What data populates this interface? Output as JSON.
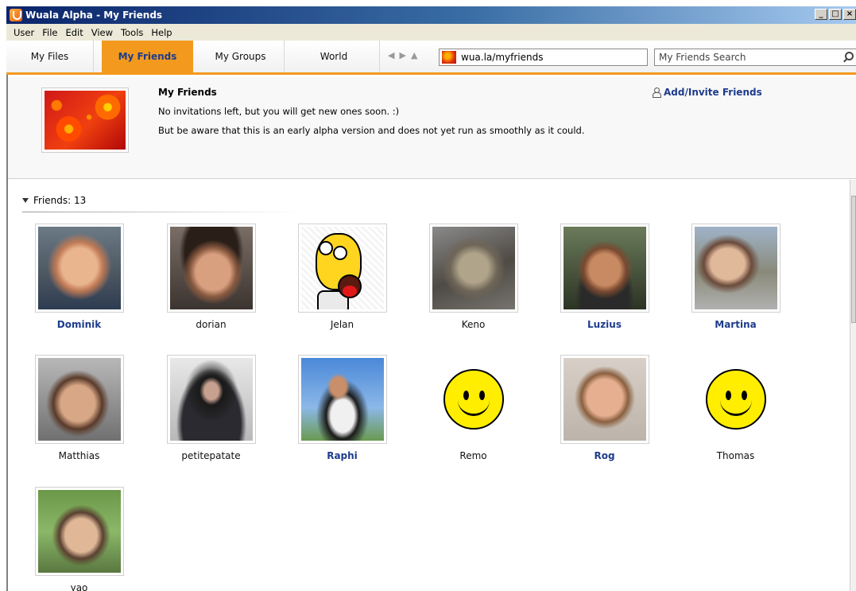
{
  "window": {
    "title": "Wuala Alpha - My Friends",
    "controls": [
      "_",
      "□",
      "×"
    ]
  },
  "menu": [
    "User",
    "File",
    "Edit",
    "View",
    "Tools",
    "Help"
  ],
  "tabs": [
    {
      "label": "My Files",
      "active": false
    },
    {
      "label": "My Friends",
      "active": true
    },
    {
      "label": "My Groups",
      "active": false
    },
    {
      "label": "World",
      "active": false
    }
  ],
  "nav": {
    "back": "◀",
    "forward": "▶",
    "up": "▲"
  },
  "address": {
    "value": "wua.la/myfriends"
  },
  "search": {
    "placeholder": "My Friends Search"
  },
  "header": {
    "title": "My Friends",
    "line1": "No invitations left, but you will get new ones soon. :)",
    "line2": "But be aware that this is an early alpha version and does not yet run as smoothly as it could.",
    "invite_label": "Add/Invite Friends"
  },
  "friends": {
    "label": "Friends: 13",
    "items": [
      {
        "name": "Dominik",
        "bold": true,
        "photo": "photo"
      },
      {
        "name": "dorian",
        "bold": false,
        "photo": "photo"
      },
      {
        "name": "Jelan",
        "bold": false,
        "photo": "cartoon"
      },
      {
        "name": "Keno",
        "bold": false,
        "photo": "photo"
      },
      {
        "name": "Luzius",
        "bold": true,
        "photo": "photo"
      },
      {
        "name": "Martina",
        "bold": true,
        "photo": "photo"
      },
      {
        "name": "Matthias",
        "bold": false,
        "photo": "photo"
      },
      {
        "name": "petitepatate",
        "bold": false,
        "photo": "photo"
      },
      {
        "name": "Raphi",
        "bold": true,
        "photo": "photo"
      },
      {
        "name": "Remo",
        "bold": false,
        "photo": "smiley"
      },
      {
        "name": "Rog",
        "bold": true,
        "photo": "photo"
      },
      {
        "name": "Thomas",
        "bold": false,
        "photo": "smiley"
      },
      {
        "name": "yao",
        "bold": false,
        "photo": "photo"
      }
    ]
  },
  "colors": {
    "accent": "#f39a1e",
    "link": "#1e3c8c",
    "titlebar": "#0a246a"
  }
}
